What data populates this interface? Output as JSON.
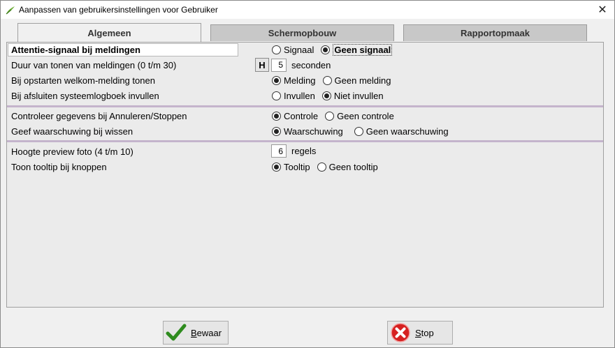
{
  "window": {
    "title": "Aanpassen van gebruikersinstellingen voor Gebruiker",
    "close_label": "✕"
  },
  "tabs": [
    {
      "label": "Algemeen",
      "active": true
    },
    {
      "label": "Schermopbouw",
      "active": false
    },
    {
      "label": "Rapportopmaak",
      "active": false
    }
  ],
  "settings": {
    "attentie": {
      "label": "Attentie-signaal bij meldingen",
      "opt1": "Signaal",
      "opt2": "Geen signaal",
      "selected": 2
    },
    "duur": {
      "label": "Duur van tonen van meldingen (0 t/m 30)",
      "h_button": "H",
      "value": "5",
      "unit": "seconden"
    },
    "welkom": {
      "label": "Bij opstarten welkom-melding tonen",
      "opt1": "Melding",
      "opt2": "Geen melding",
      "selected": 1
    },
    "logboek": {
      "label": "Bij afsluiten systeemlogboek invullen",
      "opt1": "Invullen",
      "opt2": "Niet invullen",
      "selected": 2
    },
    "controle": {
      "label": "Controleer gegevens bij Annuleren/Stoppen",
      "opt1": "Controle",
      "opt2": "Geen controle",
      "selected": 1
    },
    "wissen": {
      "label": "Geef waarschuwing bij wissen",
      "opt1": "Waarschuwing",
      "opt2": "Geen waarschuwing",
      "selected": 1
    },
    "preview": {
      "label": "Hoogte preview foto (4 t/m 10)",
      "value": "6",
      "unit": "regels"
    },
    "tooltip": {
      "label": "Toon tooltip bij knoppen",
      "opt1": "Tooltip",
      "opt2": "Geen tooltip",
      "selected": 1
    }
  },
  "buttons": {
    "save": {
      "label_first": "B",
      "label_rest": "ewaar",
      "icon": "checkmark-icon"
    },
    "stop": {
      "label_first": "S",
      "label_rest": "top",
      "icon": "stop-x-icon"
    }
  },
  "colors": {
    "separator": "#c4b4cc",
    "save_check": "#2e8b1e",
    "stop_red": "#d62020"
  }
}
